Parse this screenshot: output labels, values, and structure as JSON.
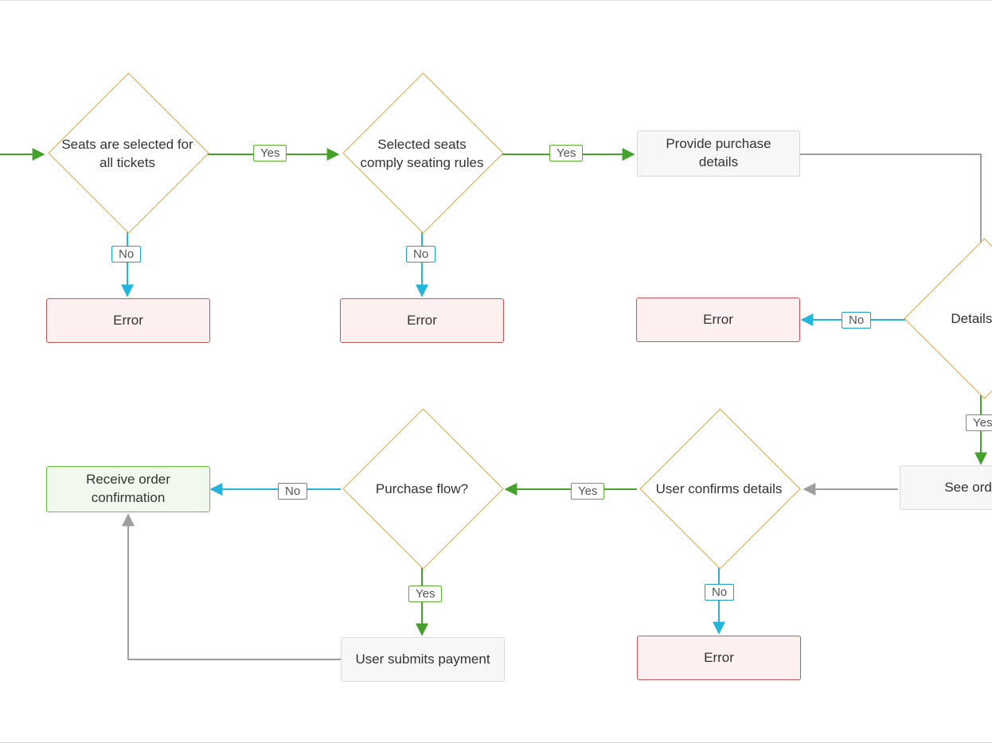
{
  "nodes": {
    "d_seats": "Seats are selected for all tickets",
    "d_rules": "Selected seats comply seating rules",
    "d_details_ok": "Details are",
    "d_confirm": "User confirms details",
    "d_purchase_flow": "Purchase flow?",
    "p_provide": "Provide purchase details",
    "p_see_summary": "See order su",
    "p_submit_pay": "User submits payment",
    "r_confirm": "Receive order confirmation",
    "err1": "Error",
    "err2": "Error",
    "err3": "Error",
    "err4": "Error"
  },
  "labels": {
    "yes": "Yes",
    "no": "No"
  },
  "colors": {
    "yes": "#44a12b",
    "no": "#24b6da",
    "neutral": "#9e9e9e"
  }
}
